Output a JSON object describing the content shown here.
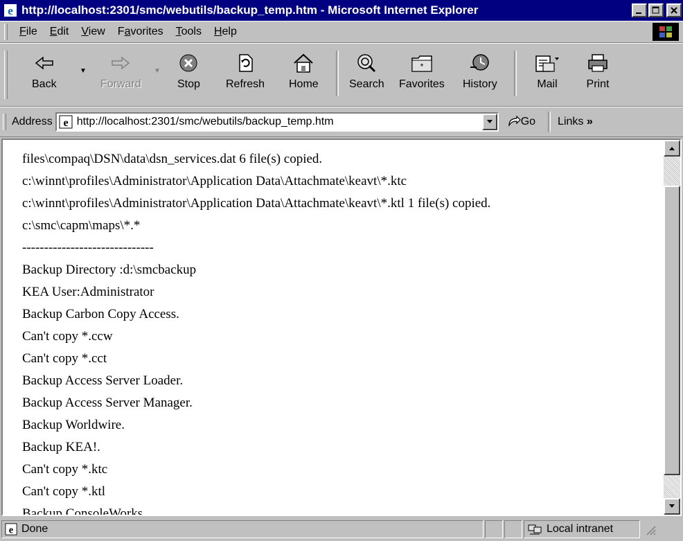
{
  "window": {
    "title": "http://localhost:2301/smc/webutils/backup_temp.htm - Microsoft Internet Explorer"
  },
  "menu": {
    "items": [
      {
        "label": "File",
        "key": "F",
        "rest": "ile"
      },
      {
        "label": "Edit",
        "key": "E",
        "rest": "dit"
      },
      {
        "label": "View",
        "key": "V",
        "rest": "iew"
      },
      {
        "label": "Favorites",
        "pre": "F",
        "key": "a",
        "rest": "vorites"
      },
      {
        "label": "Tools",
        "key": "T",
        "rest": "ools"
      },
      {
        "label": "Help",
        "key": "H",
        "rest": "elp"
      }
    ]
  },
  "toolbar": {
    "back": "Back",
    "forward": "Forward",
    "stop": "Stop",
    "refresh": "Refresh",
    "home": "Home",
    "search": "Search",
    "favorites": "Favorites",
    "history": "History",
    "mail": "Mail",
    "print": "Print"
  },
  "address": {
    "label": "Address",
    "url": "http://localhost:2301/smc/webutils/backup_temp.htm",
    "go": "Go",
    "links": "Links"
  },
  "content": {
    "lines": [
      "files\\compaq\\DSN\\data\\dsn_services.dat 6 file(s) copied.",
      "c:\\winnt\\profiles\\Administrator\\Application Data\\Attachmate\\keavt\\*.ktc",
      "c:\\winnt\\profiles\\Administrator\\Application Data\\Attachmate\\keavt\\*.ktl 1 file(s) copied.",
      "c:\\smc\\capm\\maps\\*.*",
      "------------------------------",
      "Backup Directory :d:\\smcbackup",
      "KEA User:Administrator",
      "Backup Carbon Copy Access.",
      "Can't copy *.ccw",
      "Can't copy *.cct",
      "Backup Access Server Loader.",
      "Backup Access Server Manager.",
      "Backup Worldwire.",
      "Backup KEA!.",
      "Can't copy *.ktc",
      "Can't copy *.ktl",
      "Backup ConsoleWorks."
    ]
  },
  "status": {
    "text": "Done",
    "zone": "Local intranet"
  },
  "colors": {
    "titlebar": "#000080",
    "chrome": "#c0c0c0"
  }
}
